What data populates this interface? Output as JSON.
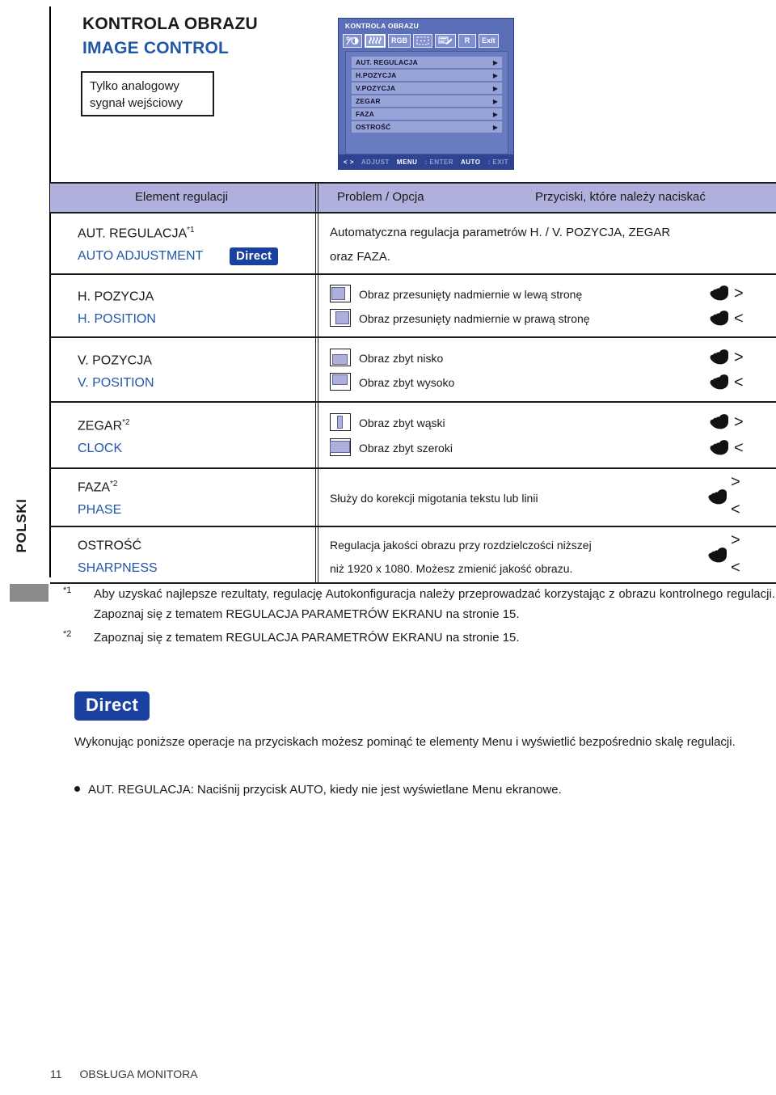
{
  "page": {
    "title_pl": "KONTROLA OBRAZU",
    "title_en": "IMAGE CONTROL",
    "analog_note": "Tylko analogowy sygnał wejściowy",
    "language_tab": "POLSKI",
    "footer_page": "11",
    "footer_section": "OBSŁUGA MONITORA"
  },
  "osd": {
    "title": "KONTROLA OBRAZU",
    "icons": [
      {
        "name": "brightness-contrast-icon",
        "label": ""
      },
      {
        "name": "image-control-icon",
        "label": ""
      },
      {
        "name": "rgb-icon",
        "label": "RGB"
      },
      {
        "name": "screen-adjust-icon",
        "label": ""
      },
      {
        "name": "setup-menu-icon",
        "label": ""
      },
      {
        "name": "recall-icon",
        "label": "R"
      },
      {
        "name": "exit-icon",
        "label": "Exit"
      }
    ],
    "menu_items": [
      {
        "label": "AUT. REGULACJA",
        "arrow": "▶"
      },
      {
        "label": "H.POZYCJA",
        "arrow": "▶"
      },
      {
        "label": "V.POZYCJA",
        "arrow": "▶"
      },
      {
        "label": "ZEGAR",
        "arrow": "▶"
      },
      {
        "label": "FAZA",
        "arrow": "▶"
      },
      {
        "label": "OSTROŚĆ",
        "arrow": "▶"
      }
    ],
    "status": {
      "adjust_keys": "< >",
      "adjust_label": "ADJUST",
      "menu_key": "MENU",
      "menu_label": ": ENTER",
      "auto_key": "AUTO",
      "auto_label": ": EXIT"
    }
  },
  "table": {
    "headers": {
      "col1": "Element regulacji",
      "col2": "Problem / Opcja",
      "col3": "Przyciski, które należy naciskać"
    },
    "rows": [
      {
        "name_pl": "AUT. REGULACJA",
        "footnote_pl": "*1",
        "name_en": "AUTO ADJUSTMENT",
        "badge": "Direct",
        "desc_line1": "Automatyczna regulacja parametrów H. / V. POZYCJA, ZEGAR",
        "desc_line2": "oraz FAZA."
      },
      {
        "name_pl": "H. POZYCJA",
        "footnote_pl": "",
        "name_en": "H. POSITION",
        "opt1": "Obraz przesunięty nadmiernie w lewą stronę",
        "opt2": "Obraz przesunięty nadmiernie w prawą stronę",
        "chev1": ">",
        "chev2": "<"
      },
      {
        "name_pl": "V. POZYCJA",
        "footnote_pl": "",
        "name_en": "V. POSITION",
        "opt1": "Obraz zbyt nisko",
        "opt2": "Obraz zbyt wysoko",
        "chev1": ">",
        "chev2": "<"
      },
      {
        "name_pl": "ZEGAR",
        "footnote_pl": "*2",
        "name_en": "CLOCK",
        "opt1": "Obraz zbyt wąski",
        "opt2": "Obraz zbyt szeroki",
        "chev1": ">",
        "chev2": "<"
      },
      {
        "name_pl": "FAZA",
        "footnote_pl": "*2",
        "name_en": "PHASE",
        "opt1": "Służy do korekcji migotania tekstu lub linii",
        "chev1": ">",
        "chev2": "<"
      },
      {
        "name_pl": "OSTROŚĆ",
        "footnote_pl": "",
        "name_en": "SHARPNESS",
        "opt1": "Regulacja jakości obrazu przy rozdzielczości niższej",
        "opt2": "niż 1920 x 1080. Możesz zmienić jakość obrazu.",
        "chev1": ">",
        "chev2": "<"
      }
    ]
  },
  "notes": [
    {
      "mark": "*1",
      "text": "Aby uzyskać najlepsze rezultaty, regulację Autokonfiguracja należy przeprowadzać korzystając z obrazu kontrolnego regulacji. Zapoznaj się z tematem REGULACJA PARAMETRÓW EKRANU na stronie 15."
    },
    {
      "mark": "*2",
      "text": "Zapoznaj się z tematem REGULACJA PARAMETRÓW EKRANU na stronie 15."
    }
  ],
  "direct_section": {
    "badge": "Direct",
    "intro": "Wykonując poniższe operacje na przyciskach możesz pominąć te elementy Menu i wyświetlić bezpośrednio skalę regulacji.",
    "bullet": "AUT. REGULACJA: Naciśnij przycisk AUTO, kiedy nie jest wyświetlane Menu ekranowe."
  },
  "colors": {
    "accent_blue": "#2157a8",
    "badge_blue": "#1b41a0",
    "header_row": "#b0b0de",
    "osd_bg": "#5b6fb8",
    "osd_row": "#98a3d8",
    "osd_status": "#2e4392",
    "thumb_fill": "#aeb0dc"
  }
}
